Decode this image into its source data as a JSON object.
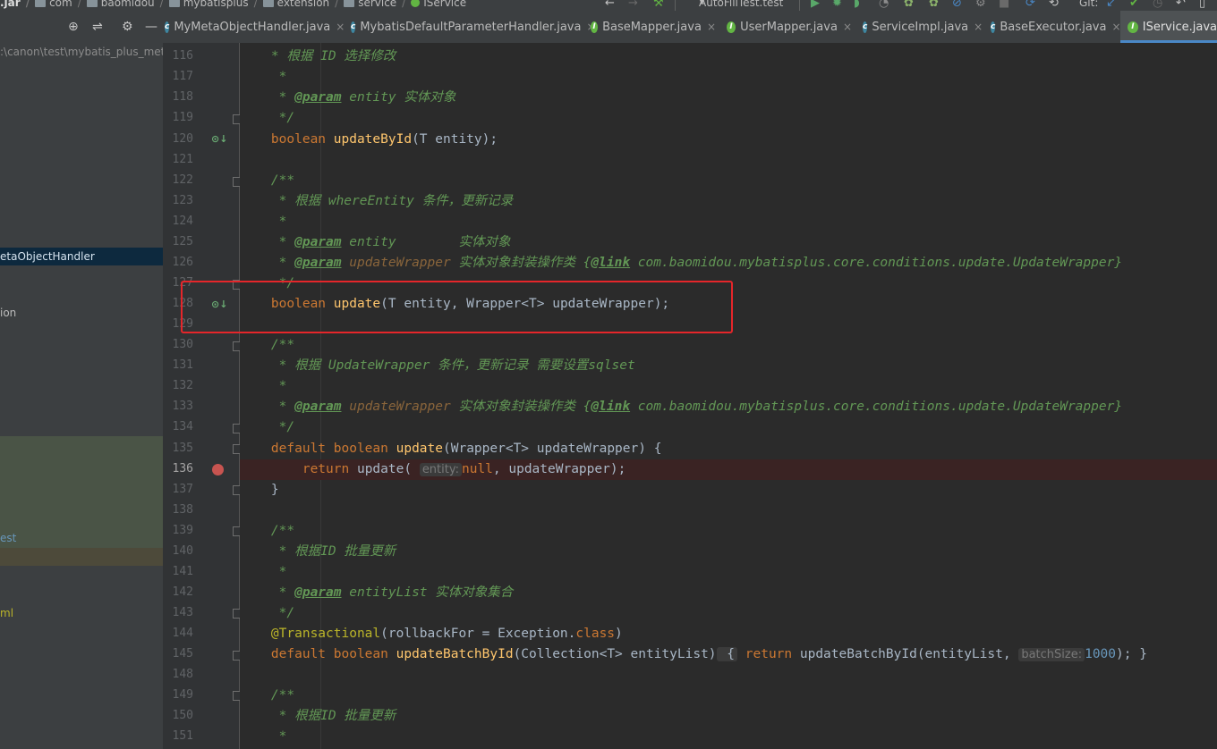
{
  "breadcrumb": [
    {
      "label": ".jar",
      "icon": "jar-icon"
    },
    {
      "label": "com",
      "icon": "package-icon"
    },
    {
      "label": "baomidou",
      "icon": "package-icon"
    },
    {
      "label": "mybatisplus",
      "icon": "package-icon"
    },
    {
      "label": "extension",
      "icon": "package-icon"
    },
    {
      "label": "service",
      "icon": "package-icon"
    },
    {
      "label": "IService",
      "icon": "interface-icon"
    }
  ],
  "toolbar": {
    "run_config": "AutoFillTest.test",
    "vcs_label": "Git:"
  },
  "project_panel": {
    "path": ":\\canon\\test\\mybatis_plus_meta",
    "items": [
      {
        "label": "etaObjectHandler",
        "state": "selected"
      },
      {
        "label": "ion",
        "state": "normal"
      },
      {
        "label": "est",
        "state": "highlight"
      },
      {
        "label": "ml",
        "state": "yellow"
      }
    ]
  },
  "tabs": [
    {
      "label": "MyMetaObjectHandler.java",
      "icon": "class-icon",
      "active": false
    },
    {
      "label": "MybatisDefaultParameterHandler.java",
      "icon": "class-icon",
      "active": false
    },
    {
      "label": "BaseMapper.java",
      "icon": "interface-icon",
      "active": false
    },
    {
      "label": "UserMapper.java",
      "icon": "interface-icon",
      "active": false
    },
    {
      "label": "ServiceImpl.java",
      "icon": "class-icon",
      "active": false
    },
    {
      "label": "BaseExecutor.java",
      "icon": "class-icon",
      "active": false
    },
    {
      "label": "IService.java",
      "icon": "interface-icon",
      "active": true
    }
  ],
  "editor": {
    "line_numbers": [
      "116",
      "117",
      "118",
      "119",
      "120",
      "121",
      "122",
      "123",
      "124",
      "125",
      "126",
      "127",
      "128",
      "129",
      "130",
      "131",
      "132",
      "133",
      "134",
      "135",
      "136",
      "137",
      "138",
      "139",
      "140",
      "141",
      "142",
      "143",
      "144",
      "145",
      "148",
      "149",
      "150",
      "151"
    ],
    "current_line": "136",
    "breakpoint_line": "136",
    "highlighted_line": "128",
    "highlight_color": "#e5262a",
    "code": {
      "l116": "* 根据 ID 选择修改",
      "l118_tag": "@param",
      "l118_rest": " entity 实体对象",
      "l120_kw": "boolean",
      "l120_fn": "updateById",
      "l120_args": "(T entity);",
      "l122": "/**",
      "l123": "* 根据 whereEntity 条件，更新记录",
      "l125_tag": "@param",
      "l125_rest": " entity        实体对象",
      "l126_tag": "@param",
      "l126_ref": " updateWrapper",
      "l126_rest": " 实体对象封装操作类 {",
      "l126_link": "@link",
      "l126_tail": " com.baomidou.mybatisplus.core.conditions.update.UpdateWrapper}",
      "l128_kw": "boolean",
      "l128_fn": "update",
      "l128_args": "(T entity, Wrapper<T> updateWrapper);",
      "l130": "/**",
      "l131": "* 根据 UpdateWrapper 条件，更新记录 需要设置sqlset",
      "l133_tag": "@param",
      "l133_ref": " updateWrapper",
      "l133_rest": " 实体对象封装操作类 {",
      "l133_link": "@link",
      "l133_tail": " com.baomidou.mybatisplus.core.conditions.update.UpdateWrapper}",
      "l135_kw": "default boolean",
      "l135_fn": "update",
      "l135_args": "(Wrapper<T> updateWrapper) {",
      "l136_kw": "return",
      "l136_call": " update(",
      "l136_hint": "entity:",
      "l136_null": "null",
      "l136_tail": ", updateWrapper);",
      "l137": "}",
      "l139": "/**",
      "l140": "* 根据ID 批量更新",
      "l142_tag": "@param",
      "l142_rest": " entityList 实体对象集合",
      "l144_ann": "@Transactional",
      "l144_args": "(rollbackFor = Exception.",
      "l144_cls": "class",
      "l144_end": ")",
      "l145_kw": "default boolean",
      "l145_fn": "updateBatchById",
      "l145_args": "(Collection<T> entityList)",
      "l145_open": " {",
      "l145_ret": "return",
      "l145_call": " updateBatchById(entityList, ",
      "l145_hint": "batchSize:",
      "l145_num": "1000",
      "l145_close": "); }",
      "l149": "/**",
      "l150": "* 根据ID 批量更新"
    }
  }
}
